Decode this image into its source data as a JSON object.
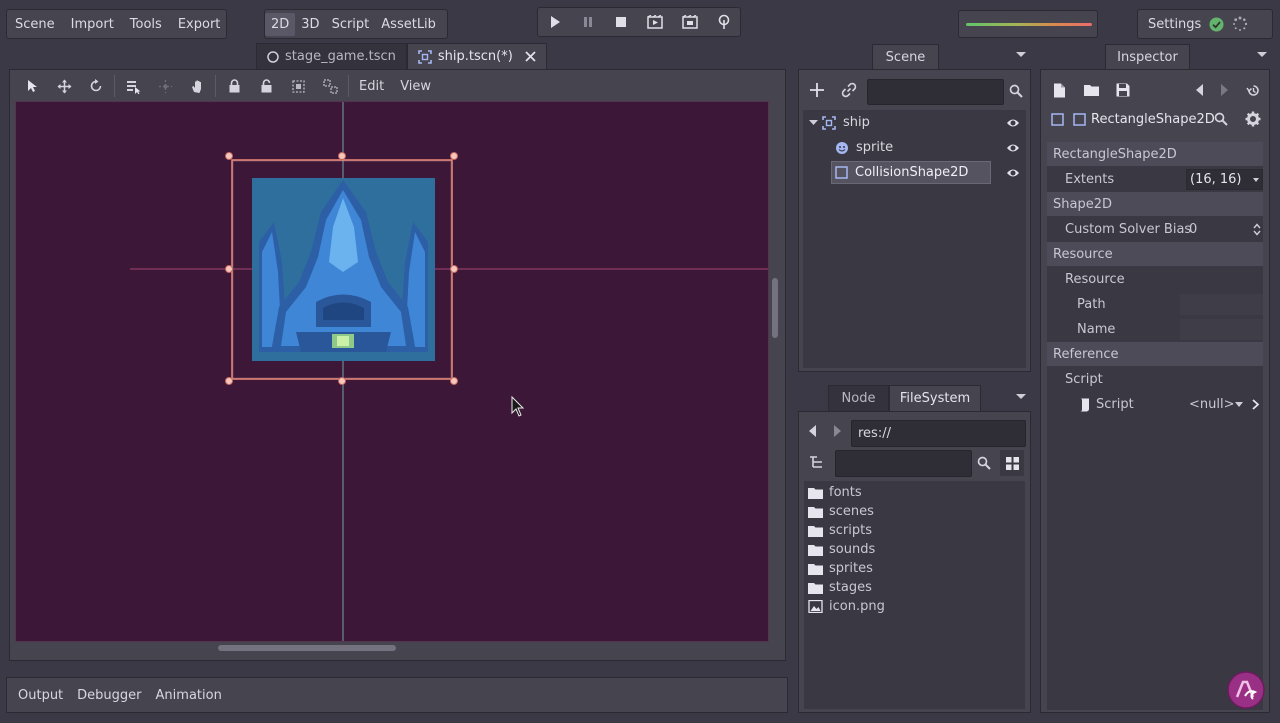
{
  "menu": {
    "scene": "Scene",
    "import": "Import",
    "tools": "Tools",
    "export": "Export"
  },
  "modes": {
    "2d": "2D",
    "3d": "3D",
    "script": "Script",
    "assetlib": "AssetLib"
  },
  "settings_label": "Settings",
  "scene_tabs": [
    {
      "label": "stage_game.tscn"
    },
    {
      "label": "ship.tscn(*)"
    }
  ],
  "viewport_menus": {
    "edit": "Edit",
    "view": "View"
  },
  "bottom_tabs": {
    "output": "Output",
    "debugger": "Debugger",
    "animation": "Animation"
  },
  "scene_dock": {
    "title": "Scene",
    "nodes": [
      {
        "label": "ship"
      },
      {
        "label": "sprite"
      },
      {
        "label": "CollisionShape2D"
      }
    ]
  },
  "fs_dock": {
    "tab_node": "Node",
    "tab_filesystem": "FileSystem",
    "path": "res://",
    "items": [
      {
        "label": "fonts"
      },
      {
        "label": "scenes"
      },
      {
        "label": "scripts"
      },
      {
        "label": "sounds"
      },
      {
        "label": "sprites"
      },
      {
        "label": "stages"
      },
      {
        "label": "icon.png"
      }
    ]
  },
  "inspector": {
    "title": "Inspector",
    "object": "RectangleShape2D",
    "sections": {
      "rect": "RectangleShape2D",
      "shape": "Shape2D",
      "resource": "Resource",
      "reference": "Reference"
    },
    "props": {
      "extents_label": "Extents",
      "extents_value": "(16, 16)",
      "bias_label": "Custom Solver Bias",
      "bias_value": "0",
      "resource_label": "Resource",
      "path_label": "Path",
      "name_label": "Name",
      "script_group": "Script",
      "script_label": "Script",
      "script_value": "<null>"
    }
  },
  "colors": {
    "editor_bg": "#3b3945",
    "canvas_bg": "#3d1738",
    "selection": "#f08a78",
    "ship_blue": "#3f86d6"
  }
}
